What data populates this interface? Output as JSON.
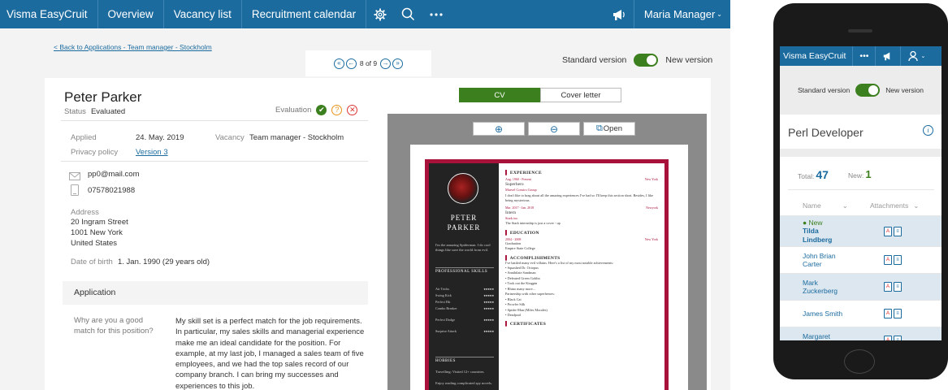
{
  "desktop": {
    "topbar": {
      "brand": "Visma EasyCruit",
      "nav": [
        "Overview",
        "Vacancy list",
        "Recruitment calendar"
      ],
      "icons": [
        "gear-icon",
        "search-icon",
        "more-icon",
        "megaphone-icon"
      ],
      "user": "Maria Manager"
    },
    "back_link": "< Back to Applications - Team manager - Stockholm",
    "pager": {
      "current": "8",
      "of": "of",
      "total": "9"
    },
    "version_toggle": {
      "standard": "Standard version",
      "new": "New version"
    },
    "candidate": {
      "name": "Peter Parker",
      "status_label": "Status",
      "status_value": "Evaluated",
      "evaluation_label": "Evaluation",
      "applied_label": "Applied",
      "applied_value": "24. May. 2019",
      "vacancy_label": "Vacancy",
      "vacancy_value": "Team manager - Stockholm",
      "privacy_label": "Privacy policy",
      "privacy_value": "Version 3",
      "email": "pp0@mail.com",
      "phone": "07578021988",
      "address_label": "Address",
      "address_lines": [
        "20 Ingram Street",
        "1001 New York",
        "United States"
      ],
      "dob_label": "Date of birth",
      "dob_value": "1. Jan. 1990 (29 years old)"
    },
    "application": {
      "heading": "Application",
      "question": "Why are you a good match for this position?",
      "answer": "My skill set is a perfect match for the job requirements. In particular, my sales skills and managerial experience make me an ideal candidate for the position. For example, at my last job, I managed a sales team of five employees, and we had the top sales record of our company branch. I can bring my successes and experiences to this job."
    },
    "doc_tabs": [
      "CV",
      "Cover letter"
    ],
    "viewer": {
      "open_label": "Open"
    },
    "cv": {
      "first": "PETER",
      "last": "PARKER",
      "intro": "I'm the amazing Spiderman. I do cool things like save the world from evil.",
      "skills_heading": "PROFESSIONAL SKILLS",
      "skills": [
        "Air Tricks",
        "Swing Kick",
        "Perfect Hit",
        "Combo Breaker",
        "Perfect Dodge",
        "Surprise Attack"
      ],
      "hobbies_heading": "HOBBIES",
      "hobbies": [
        "Travelling: Visited 12+ countries.",
        "Enjoy reading complicated spy novels."
      ],
      "experience_heading": "EXPERIENCE",
      "job1_dates": "Aug. 1960 - Present",
      "job1_place": "New York",
      "job1_title": "Superhero",
      "job1_org": "Marvel Comics Group",
      "job1_desc": "I don't like to brag about all the amazing experiences I've had so I'll keep this section short. Besides, I like being mysterious.",
      "job2_dates": "Mar. 2017 - Jan. 2018",
      "job2_place": "Newyork",
      "job2_title": "Intern",
      "job2_org": "Stark inc",
      "job2_desc": "The Stark internship is just a cover - up",
      "education_heading": "EDUCATION",
      "edu_dates": "2004 - 2008",
      "edu_place": "New York",
      "edu_title": "Graduation",
      "edu_org": "Empire State College",
      "accomplishments_heading": "ACCOMPLISHMENTS",
      "acc_intro": "I've battled many evil villains. Here's a list of my most notable achievements:",
      "acc_items": [
        "Squashed Dr. Octopus",
        "Annihilate Sandman",
        "Defeated Green Goblin",
        "Took out the Kingpin",
        "Rhino many more..."
      ],
      "partner_intro": "Partnership with other superheroes:",
      "partners": [
        "Black Cat",
        "Prowler Silk",
        "Spider-Man (Miles Morales)",
        "Deadpool"
      ],
      "certificates_heading": "CERTIFICATES"
    }
  },
  "mobile": {
    "brand": "Visma EasyCruit",
    "version_toggle": {
      "standard": "Standard version",
      "new": "New version"
    },
    "title": "Perl Developer",
    "total_label": "Total:",
    "total": "47",
    "new_label": "New:",
    "new": "1",
    "col_name": "Name",
    "col_attachments": "Attachments",
    "rows": [
      {
        "badge": "New",
        "name": "Tilda Lindberg"
      },
      {
        "badge": "",
        "name": "John Brian Carter"
      },
      {
        "badge": "",
        "name": "Mark Zuckerberg"
      },
      {
        "badge": "",
        "name": "James Smith"
      },
      {
        "badge": "",
        "name": "Margaret Melrose"
      }
    ]
  },
  "colors": {
    "brand_blue": "#1b6b9f",
    "accent_green": "#3c7f1f",
    "cv_red": "#a8123a"
  }
}
